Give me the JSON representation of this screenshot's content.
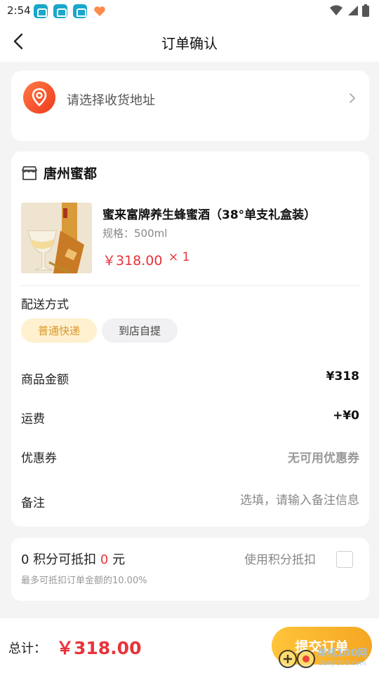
{
  "status_bar": {
    "time": "2:54",
    "notification_icons": [
      "app-notification-icon",
      "app-notification-icon",
      "app-notification-icon",
      "heart-app-icon"
    ],
    "system_icons": [
      "wifi-icon",
      "signal-icon",
      "battery-icon"
    ]
  },
  "header": {
    "title": "订单确认",
    "back_icon": "chevron-left-icon"
  },
  "address": {
    "placeholder_text": "请选择收货地址",
    "icon": "location-pin-icon"
  },
  "shop": {
    "name": "唐州蜜都",
    "icon": "store-icon"
  },
  "product": {
    "name": "蜜来富牌养生蜂蜜酒（38°单支礼盒装）",
    "spec": "规格：500ml",
    "price": "￥318.00",
    "quantity": "× 1"
  },
  "delivery": {
    "label": "配送方式",
    "options": [
      {
        "label": "普通快递",
        "selected": true
      },
      {
        "label": "到店自提",
        "selected": false
      }
    ]
  },
  "summary": {
    "goods_label": "商品金额",
    "goods_value": "¥318",
    "shipping_label": "运费",
    "shipping_value": "+¥0",
    "coupon_label": "优惠券",
    "coupon_value": "无可用优惠券",
    "note_label": "备注",
    "note_placeholder": "选填，请输入备注信息"
  },
  "points": {
    "prefix": "0 积分可抵扣 ",
    "amount": "0",
    "suffix": " 元",
    "max_text": "最多可抵扣订单金额的10.00%",
    "use_label": "使用积分抵扣",
    "checked": false
  },
  "footer": {
    "total_label": "总计：",
    "total_value": "￥318.00",
    "submit_label": "提交订单"
  },
  "watermark": {
    "text": "单机100网",
    "url_text": "danji100.com"
  },
  "colors": {
    "price_red": "#e8333a",
    "accent_yellow": "#f5a623",
    "chip_active_bg": "#fff1cf"
  }
}
